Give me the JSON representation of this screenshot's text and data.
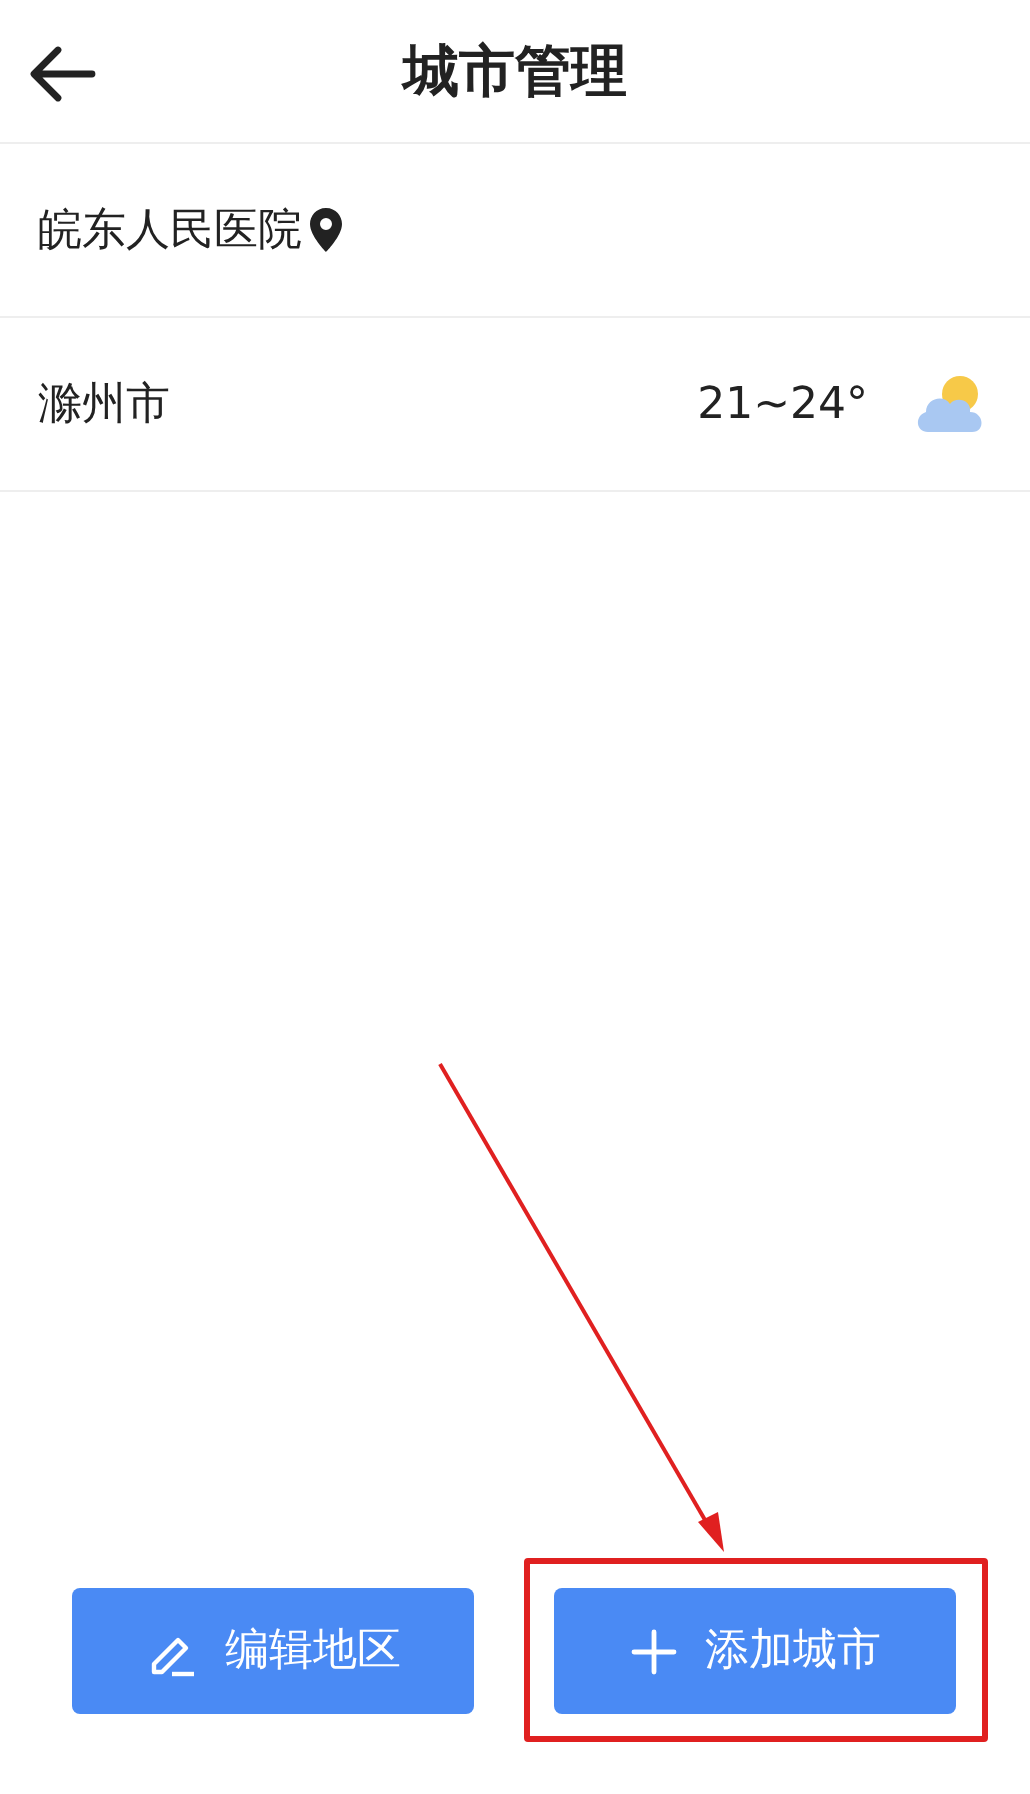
{
  "header": {
    "title": "城市管理"
  },
  "cities": [
    {
      "name": "皖东人民医院",
      "kind": "location"
    },
    {
      "name": "滁州市",
      "kind": "weather",
      "temperature": "21~24°"
    }
  ],
  "buttons": [
    {
      "label": "编辑地区",
      "kind": "edit",
      "highlighted": false
    },
    {
      "label": "添加城市",
      "kind": "add",
      "highlighted": true
    }
  ]
}
